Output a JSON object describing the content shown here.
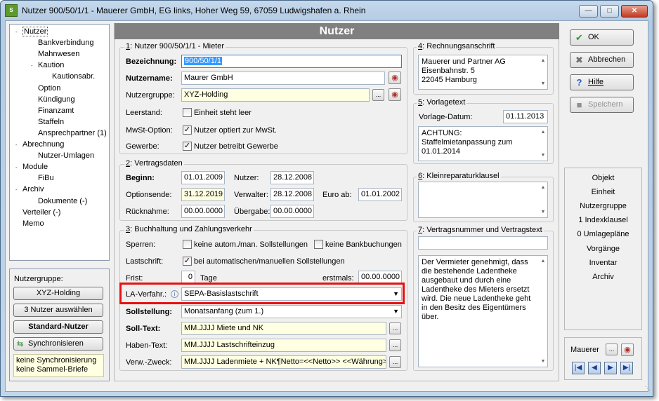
{
  "window": {
    "title": "Nutzer 900/50/1/1 - Mauerer GmbH, EG links, Hoher Weg 59, 67059 Ludwigshafen a. Rhein",
    "app_icon": "S"
  },
  "tree": {
    "items": [
      {
        "label": "Nutzer",
        "level": 0,
        "exp": "-"
      },
      {
        "label": "Bankverbindung",
        "level": 1,
        "exp": ""
      },
      {
        "label": "Mahnwesen",
        "level": 1,
        "exp": ""
      },
      {
        "label": "Kaution",
        "level": 1,
        "exp": "-"
      },
      {
        "label": "Kautionsabr.",
        "level": 2,
        "exp": ""
      },
      {
        "label": "Option",
        "level": 1,
        "exp": ""
      },
      {
        "label": "Kündigung",
        "level": 1,
        "exp": ""
      },
      {
        "label": "Finanzamt",
        "level": 1,
        "exp": ""
      },
      {
        "label": "Staffeln",
        "level": 1,
        "exp": ""
      },
      {
        "label": "Ansprechpartner (1)",
        "level": 1,
        "exp": ""
      },
      {
        "label": "Abrechnung",
        "level": 0,
        "exp": "-"
      },
      {
        "label": "Nutzer-Umlagen",
        "level": 1,
        "exp": ""
      },
      {
        "label": "Module",
        "level": 0,
        "exp": "-"
      },
      {
        "label": "FiBu",
        "level": 1,
        "exp": ""
      },
      {
        "label": "Archiv",
        "level": 0,
        "exp": "-"
      },
      {
        "label": "Dokumente (-)",
        "level": 1,
        "exp": ""
      },
      {
        "label": "Verteiler (-)",
        "level": 0,
        "exp": ""
      },
      {
        "label": "Memo",
        "level": 0,
        "exp": ""
      }
    ]
  },
  "left_bottom": {
    "group_label": "Nutzergruppe:",
    "group_button": "XYZ-Holding",
    "select_button": "3 Nutzer auswählen",
    "standard_button": "Standard-Nutzer",
    "sync_button": "Synchronisieren",
    "note_line1": "keine Synchronisierung",
    "note_line2": "keine Sammel-Briefe"
  },
  "banner": "Nutzer",
  "s1": {
    "title_num": "1",
    "title": ": Nutzer 900/50/1/1 - Mieter",
    "bez_label": "Bezeichnung:",
    "bez_value": "900/50/1/1",
    "name_label": "Nutzername:",
    "name_value": "Maurer GmbH",
    "grp_label": "Nutzergruppe:",
    "grp_value": "XYZ-Holding",
    "leer_label": "Leerstand:",
    "leer_text": "Einheit steht leer",
    "mwst_label": "MwSt-Option:",
    "mwst_text": "Nutzer optiert zur MwSt.",
    "gew_label": "Gewerbe:",
    "gew_text": "Nutzer betreibt Gewerbe"
  },
  "s2": {
    "title_num": "2",
    "title": ": Vertragsdaten",
    "beginn_label": "Beginn:",
    "beginn_value": "01.01.2009",
    "nutzer_label": "Nutzer:",
    "nutzer_value": "28.12.2008",
    "opt_label": "Optionsende:",
    "opt_value": "31.12.2019",
    "verw_label": "Verwalter:",
    "verw_value": "28.12.2008",
    "euro_label": "Euro ab:",
    "euro_value": "01.01.2002",
    "rueck_label": "Rücknahme:",
    "rueck_value": "00.00.0000",
    "ueber_label": "Übergabe:",
    "ueber_value": "00.00.0000"
  },
  "s3": {
    "title_num": "3",
    "title": ": Buchhaltung und Zahlungsverkehr",
    "sperren_label": "Sperren:",
    "sperren_opt1": "keine autom./man. Sollstellungen",
    "sperren_opt2": "keine Bankbuchungen",
    "last_label": "Lastschrift:",
    "last_text": "bei automatischen/manuellen Sollstellungen",
    "frist_label": "Frist:",
    "frist_value": "0",
    "frist_unit": "Tage",
    "erst_label": "erstmals:",
    "erst_value": "00.00.0000",
    "la_label": "LA-Verfahr.:",
    "la_value": "SEPA-Basislastschrift",
    "soll_label": "Sollstellung:",
    "soll_value": "Monatsanfang (zum 1.)",
    "sollt_label": "Soll-Text:",
    "sollt_value": "MM.JJJJ Miete und NK",
    "haben_label": "Haben-Text:",
    "haben_value": "MM.JJJJ Lastschrifteinzug",
    "zweck_label": "Verw.-Zweck:",
    "zweck_value": "MM.JJJJ Ladenmiete + NK¶Netto=<<Netto>> <<Währung>>'"
  },
  "s4": {
    "title_num": "4",
    "title": ": Rechnungsanschrift",
    "line1": "Mauerer und Partner AG",
    "line2": "Eisenbahnstr. 5",
    "line3": "22045 Hamburg"
  },
  "s5": {
    "title_num": "5",
    "title": ": Vorlagetext",
    "date_label": "Vorlage-Datum:",
    "date_value": "01.11.2013",
    "line1": "ACHTUNG:",
    "line2": "Staffelmietanpassung zum",
    "line3": "01.01.2014"
  },
  "s6": {
    "title_num": "6",
    "title": ": Kleinreparaturklausel"
  },
  "s7": {
    "title_num": "7",
    "title": ": Vertragsnummer und Vertragstext",
    "text1": "Der Vermieter genehmigt, dass",
    "text2": "die bestehende Ladentheke",
    "text3": "ausgebaut und durch eine",
    "text4": "Ladentheke des Mieters ersetzt",
    "text5": "wird. Die neue Ladentheke geht",
    "text6": "in den Besitz des Eigentümers",
    "text7": "über."
  },
  "buttons": {
    "ok": "OK",
    "cancel": "Abbrechen",
    "help": "Hilfe",
    "save": "Speichern"
  },
  "links": [
    "Objekt",
    "Einheit",
    "Nutzergruppe",
    "1 Indexklausel",
    "0 Umlagepläne",
    "Vorgänge",
    "Inventar",
    "Archiv"
  ],
  "nav": {
    "value": "Mauerer"
  },
  "colors": {
    "highlight": "#e81010",
    "banner": "#808080",
    "field_yellow": "#ffffe1"
  }
}
